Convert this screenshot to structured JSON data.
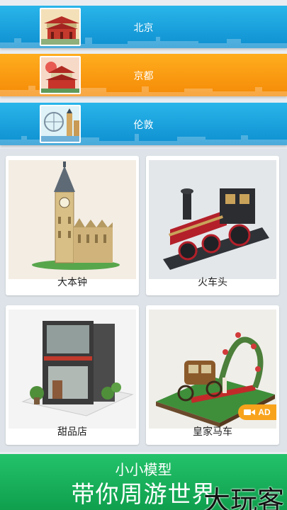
{
  "banners": [
    {
      "label": "北京",
      "icon": "beijing-gate-icon"
    },
    {
      "label": "京都",
      "icon": "kyoto-temple-icon"
    },
    {
      "label": "伦敦",
      "icon": "london-eye-icon"
    }
  ],
  "cards": [
    {
      "label": "大本钟"
    },
    {
      "label": "火车头"
    },
    {
      "label": "甜品店"
    },
    {
      "label": "皇家马车",
      "ad": "AD"
    }
  ],
  "bottom_banner": {
    "line1": "小小模型",
    "line2": "带你周游世界"
  },
  "watermark": "大玩客"
}
